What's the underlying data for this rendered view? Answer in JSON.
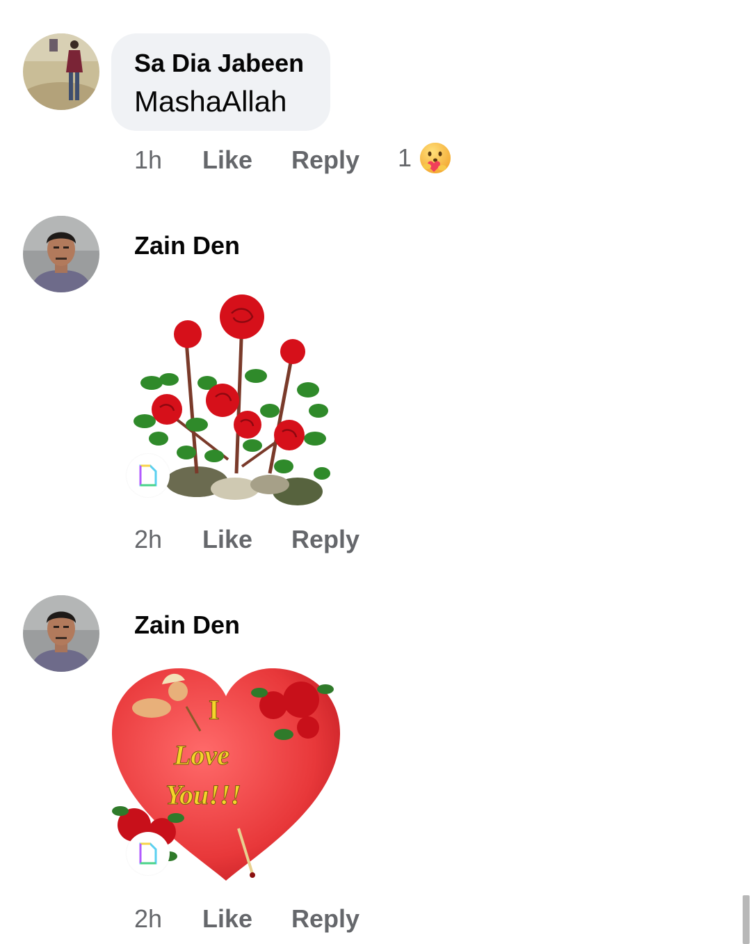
{
  "comments": [
    {
      "author": "Sa Dia Jabeen",
      "text": "MashaAllah",
      "time": "1h",
      "like_label": "Like",
      "reply_label": "Reply",
      "reaction_count": "1",
      "reaction_icon": "care-emoji-icon",
      "avatar_icon": "person-standing-photo"
    },
    {
      "author": "Zain Den",
      "time": "2h",
      "like_label": "Like",
      "reply_label": "Reply",
      "sticker": "red-roses-gif",
      "avatar_icon": "man-portrait-photo"
    },
    {
      "author": "Zain Den",
      "time": "2h",
      "like_label": "Like",
      "reply_label": "Reply",
      "sticker": "i-love-you-heart-gif",
      "sticker_text": [
        "I",
        "Love",
        "You!!!"
      ],
      "avatar_icon": "man-portrait-photo"
    }
  ],
  "colors": {
    "bubble": "#f0f2f5",
    "meta_text": "#65676b",
    "author_text": "#050505",
    "heart_red": "#e8383a",
    "rose_red": "#d6101a",
    "leaf_green": "#2f8a2a"
  }
}
